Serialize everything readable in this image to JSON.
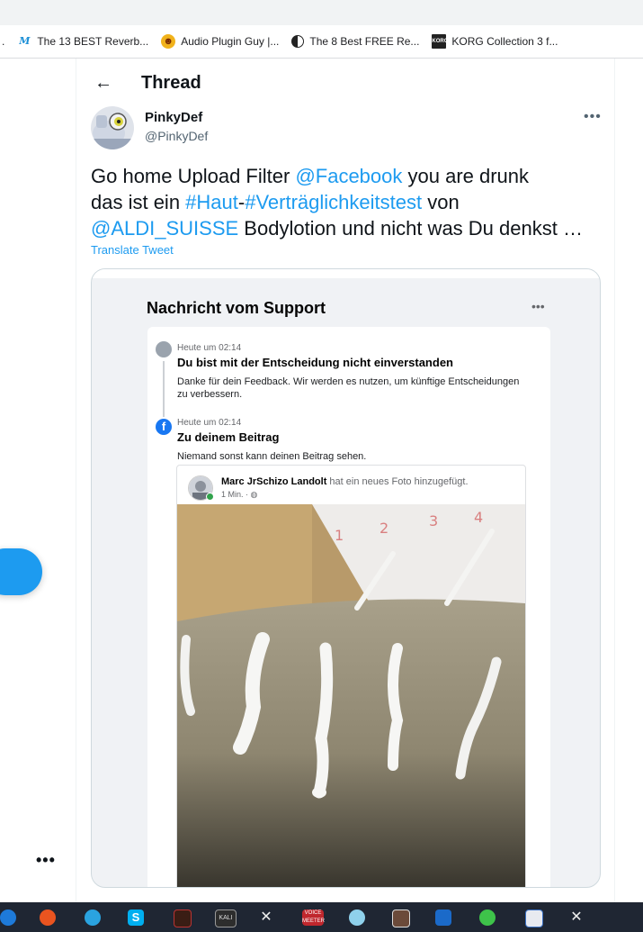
{
  "bookmarks": [
    {
      "label": "The 13 BEST Reverb...",
      "icon": "m-script-icon"
    },
    {
      "label": "Audio Plugin Guy |...",
      "icon": "plugin-guy-icon"
    },
    {
      "label": "The 8 Best FREE Re...",
      "icon": "half-circle-icon"
    },
    {
      "label": "KORG Collection 3 f...",
      "icon": "korg-icon"
    }
  ],
  "header": {
    "title": "Thread"
  },
  "tweet": {
    "name": "PinkyDef",
    "handle": "@PinkyDef",
    "line1_plain_a": "Go home Upload Filter ",
    "line1_mention": "@Facebook",
    "line1_plain_b": " you are drunk",
    "line2_plain_a": "das ist ein ",
    "line2_tag_a": "#Haut",
    "line2_dash": "-",
    "line2_tag_b": "#Verträglichkeitstest",
    "line2_plain_b": " von",
    "line3_mention": "@ALDI_SUISSE",
    "line3_plain": " Bodylotion und nicht was Du denkst …",
    "translate": "Translate Tweet"
  },
  "fb_screenshot": {
    "title": "Nachricht vom Support",
    "msg1": {
      "time": "Heute um 02:14",
      "heading": "Du bist mit der Entscheidung nicht einverstanden",
      "body_line1": "Danke für dein Feedback. Wir werden es nutzen, um künftige Entscheidungen",
      "body_line2": "zu verbessern."
    },
    "msg2": {
      "time": "Heute um 02:14",
      "heading": "Zu deinem Beitrag",
      "body": "Niemand sonst kann deinen Beitrag sehen."
    },
    "post": {
      "author": "Marc JrSchizo Landolt",
      "action": " hat ein neues Foto hinzugefügt.",
      "meta": "1 Min. · ◍"
    }
  },
  "colors": {
    "link": "#1d9bf0",
    "taskbar": "#1f2633"
  }
}
